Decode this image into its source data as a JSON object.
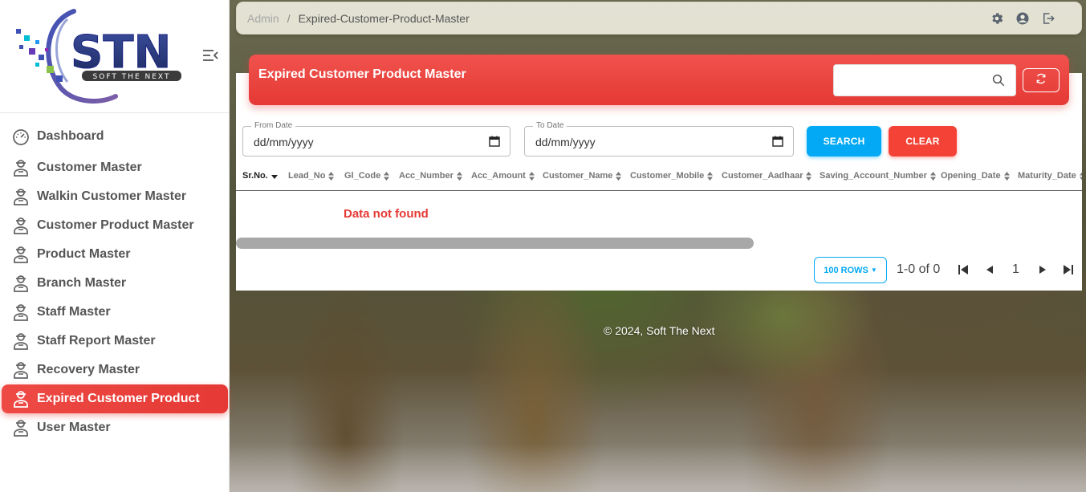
{
  "brand": {
    "logo_text": "STN",
    "tagline": "SOFT THE NEXT"
  },
  "sidebar": {
    "items": [
      {
        "label": "Dashboard",
        "icon": "dashboard-icon"
      },
      {
        "label": "Customer Master",
        "icon": "user-icon"
      },
      {
        "label": "Walkin Customer Master",
        "icon": "user-icon"
      },
      {
        "label": "Customer Product Master",
        "icon": "user-icon"
      },
      {
        "label": "Product Master",
        "icon": "user-icon"
      },
      {
        "label": "Branch Master",
        "icon": "user-icon"
      },
      {
        "label": "Staff Master",
        "icon": "user-icon"
      },
      {
        "label": "Staff Report Master",
        "icon": "user-icon"
      },
      {
        "label": "Recovery Master",
        "icon": "user-icon"
      },
      {
        "label": "Expired Customer Product",
        "icon": "user-icon",
        "active": true
      },
      {
        "label": "User Master",
        "icon": "user-icon"
      }
    ]
  },
  "breadcrumb": {
    "root": "Admin",
    "separator": "/",
    "current": "Expired-Customer-Product-Master"
  },
  "card": {
    "title": "Expired Customer Product Master",
    "search_value": ""
  },
  "filters": {
    "from_label": "From Date",
    "from_value": "dd/mm/yyyy",
    "to_label": "To Date",
    "to_value": "dd/mm/yyyy",
    "search_btn": "SEARCH",
    "clear_btn": "CLEAR"
  },
  "table": {
    "columns": [
      "Sr.No.",
      "Lead_No",
      "Gl_Code",
      "Acc_Number",
      "Acc_Amount",
      "Customer_Name",
      "Customer_Mobile",
      "Customer_Aadhaar",
      "Saving_Account_Number",
      "Opening_Date",
      "Maturity_Date"
    ],
    "empty_message": "Data not found"
  },
  "pagination": {
    "rows_label": "100 ROWS",
    "range": "1-0 of 0",
    "page": "1"
  },
  "footer": {
    "text": "© 2024, Soft The Next"
  },
  "colors": {
    "accent_red": "#e53935",
    "accent_blue": "#03a9f4"
  }
}
